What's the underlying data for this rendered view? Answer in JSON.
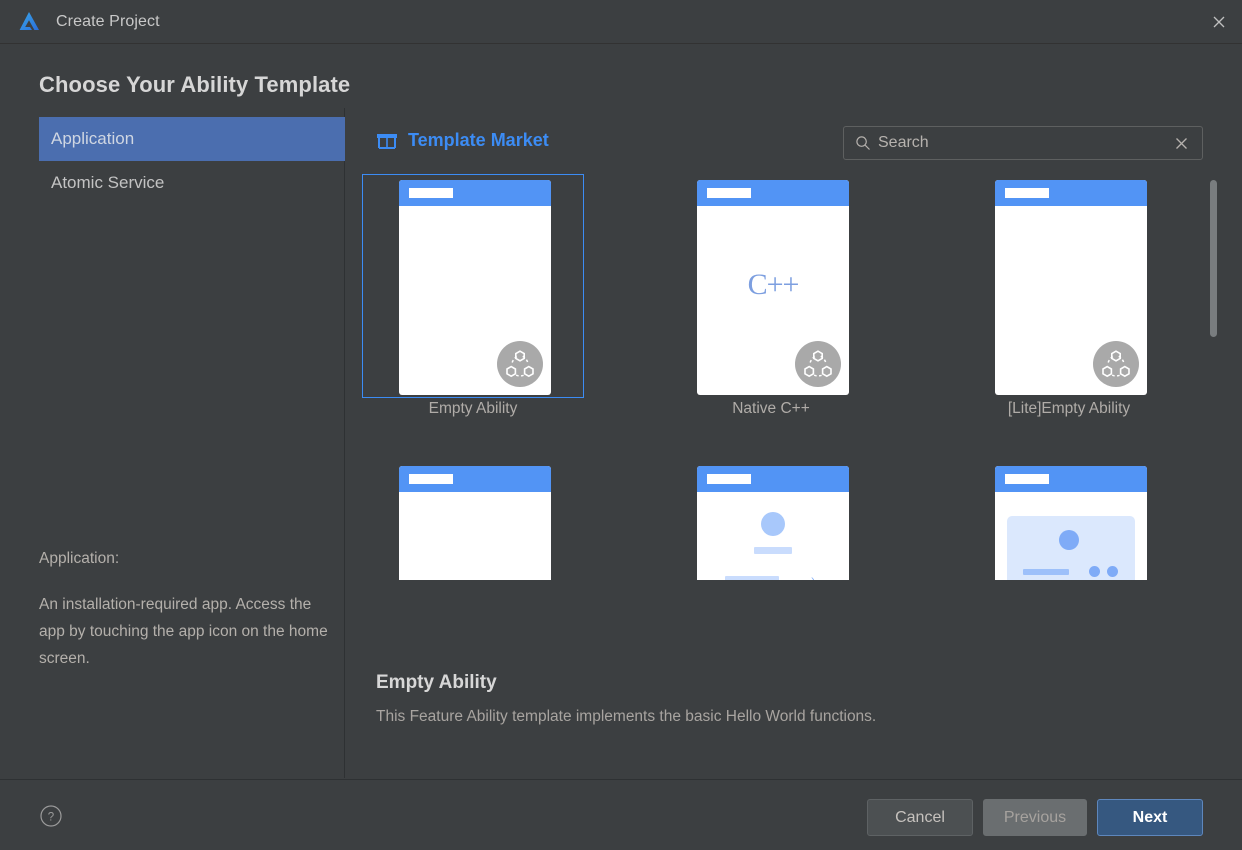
{
  "window": {
    "title": "Create Project",
    "app_icon": "deveco-logo-icon",
    "close_icon": "close-icon"
  },
  "page": {
    "title": "Choose Your Ability Template"
  },
  "sidebar": {
    "items": [
      {
        "label": "Application",
        "selected": true
      },
      {
        "label": "Atomic Service",
        "selected": false
      }
    ],
    "description": {
      "label": "Application:",
      "text": "An installation-required app. Access the app by touching the app icon on the home screen."
    }
  },
  "market": {
    "icon": "storefront-icon",
    "label": "Template Market",
    "accent_color": "#3c8cf4"
  },
  "search": {
    "icon": "search-icon",
    "placeholder": "Search",
    "value": "",
    "clear_icon": "close-icon"
  },
  "templates": [
    {
      "caption": "Empty Ability",
      "selected": true,
      "thumb": "blank"
    },
    {
      "caption": "Native C++",
      "selected": false,
      "thumb": "cpp"
    },
    {
      "caption": "[Lite]Empty Ability",
      "selected": false,
      "thumb": "blank"
    },
    {
      "caption": "",
      "selected": false,
      "thumb": "blank"
    },
    {
      "caption": "",
      "selected": false,
      "thumb": "list"
    },
    {
      "caption": "",
      "selected": false,
      "thumb": "panel"
    }
  ],
  "template_cpp_label": "C++",
  "selected_template": {
    "name": "Empty Ability",
    "description": "This Feature Ability template implements the basic Hello World functions."
  },
  "footer": {
    "help_icon": "help-circle-icon",
    "buttons": {
      "cancel": "Cancel",
      "previous": "Previous",
      "next": "Next"
    }
  },
  "colors": {
    "background": "#3c3f41",
    "selection_blue": "#4b6eaf",
    "accent_blue": "#3c8cf4",
    "primary_button": "#365880"
  }
}
